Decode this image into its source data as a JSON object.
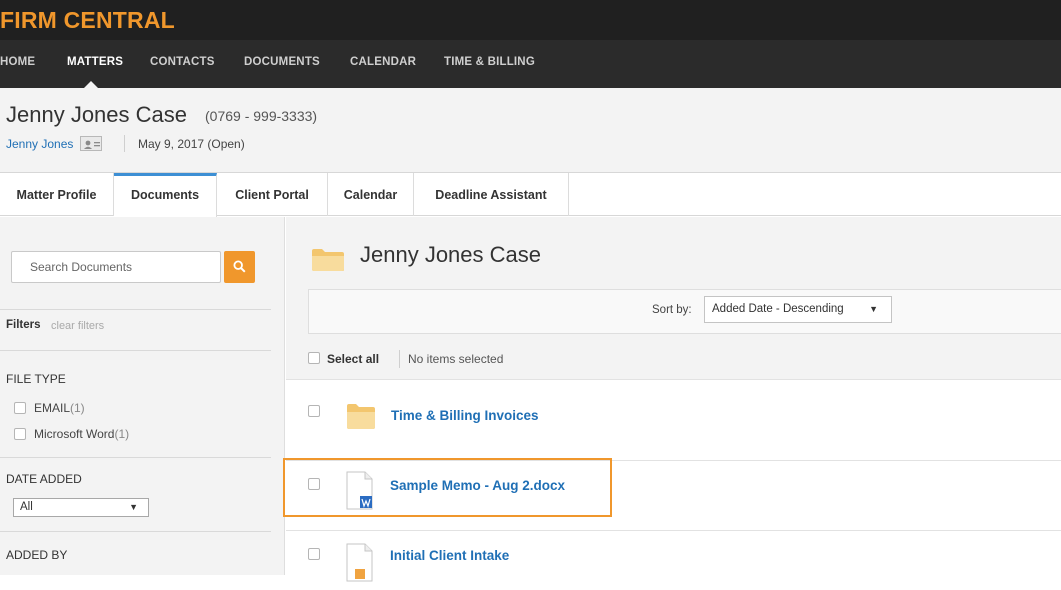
{
  "brand": {
    "name": "FIRM CENTRAL"
  },
  "nav": {
    "items": [
      "HOME",
      "MATTERS",
      "CONTACTS",
      "DOCUMENTS",
      "CALENDAR",
      "TIME & BILLING"
    ],
    "active": "MATTERS"
  },
  "case": {
    "title": "Jenny Jones Case",
    "number": "(0769 - 999-3333)",
    "client": "Jenny Jones",
    "date_status": "May 9, 2017 (Open)"
  },
  "tabs": [
    "Matter Profile",
    "Documents",
    "Client Portal",
    "Calendar",
    "Deadline Assistant"
  ],
  "active_tab": "Documents",
  "sidebar": {
    "search_placeholder": "Search Documents",
    "filters_label": "Filters",
    "clear_filters": "clear filters",
    "file_type": {
      "heading": "FILE TYPE",
      "options": [
        {
          "label": "EMAIL",
          "count": "(1)"
        },
        {
          "label": "Microsoft Word",
          "count": "(1)"
        }
      ]
    },
    "date_added": {
      "heading": "DATE ADDED",
      "selected": "All"
    },
    "added_by": {
      "heading": "ADDED BY"
    }
  },
  "main": {
    "folder_title": "Jenny Jones Case",
    "sort_label": "Sort by:",
    "sort_value": "Added Date - Descending",
    "select_all": "Select all",
    "selection_status": "No items selected",
    "items": [
      {
        "name": "Time & Billing Invoices",
        "icon": "folder-icon"
      },
      {
        "name": "Sample Memo - Aug 2.docx",
        "icon": "word-document-icon"
      },
      {
        "name": "Initial Client Intake",
        "icon": "document-icon"
      }
    ]
  },
  "colors": {
    "accent": "#f0972c",
    "link": "#1f6fb5",
    "tab_active": "#3d8fd4",
    "nav_bg": "#2b2b2b"
  }
}
